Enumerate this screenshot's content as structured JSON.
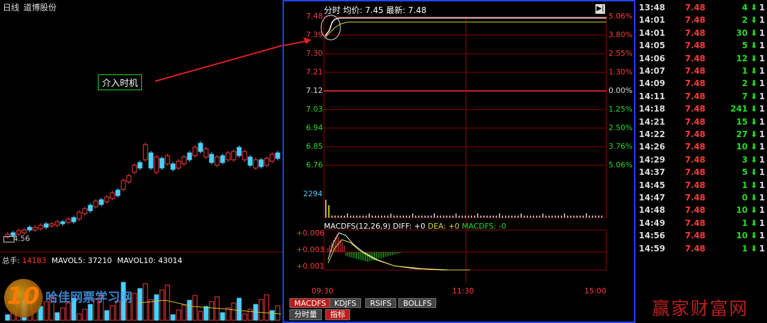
{
  "left": {
    "chart_type": "日线",
    "stock_name": "道博股份",
    "price_label": "4.56",
    "annotation": "介入时机",
    "vol_label": "总手:",
    "vol_value": "14183",
    "mavol5_label": "MAVOL5:",
    "mavol5_value": "37210",
    "mavol10_label": "MAVOL10:",
    "mavol10_value": "43014",
    "watermark_text": "哈佳网票学习网",
    "watermark_logo": "10"
  },
  "mid": {
    "title_label": "分时",
    "avg_label": "均价:",
    "avg_value": "7.45",
    "latest_label": "最新:",
    "latest_value": "7.48",
    "price_ticks": [
      "7.48",
      "7.39",
      "7.30",
      "7.21",
      "7.12",
      "7.03",
      "6.94",
      "6.85",
      "6.76"
    ],
    "pct_ticks": [
      "5.06%",
      "3.80%",
      "2.55%",
      "1.30%",
      "0.00%",
      "1.25%",
      "2.50%",
      "3.76%",
      "5.06%"
    ],
    "vol_max": "2294",
    "macd_header": "MACDFS(12,26,9)",
    "diff_text": "DIFF: +0",
    "dea_text": "DEA: +0",
    "macdfs_text": "MACDFS: -0",
    "macd_ticks": [
      "+0.006",
      "+0.003",
      "+0.001"
    ],
    "time_ticks": [
      "09:30",
      "11:30",
      "15:00"
    ],
    "tabs": [
      "MACDFS",
      "KDJFS",
      "RSIFS",
      "BOLLFS"
    ],
    "tabs2": [
      "分时量",
      "指标"
    ]
  },
  "trades": [
    {
      "time": "13:48",
      "price": "7.48",
      "vol": "4",
      "x": "1"
    },
    {
      "time": "14:01",
      "price": "7.48",
      "vol": "2",
      "x": "1"
    },
    {
      "time": "14:01",
      "price": "7.48",
      "vol": "30",
      "x": "1"
    },
    {
      "time": "14:05",
      "price": "7.48",
      "vol": "5",
      "x": "1"
    },
    {
      "time": "14:06",
      "price": "7.48",
      "vol": "12",
      "x": "1"
    },
    {
      "time": "14:07",
      "price": "7.48",
      "vol": "1",
      "x": "1"
    },
    {
      "time": "14:09",
      "price": "7.48",
      "vol": "2",
      "x": "1"
    },
    {
      "time": "14:11",
      "price": "7.48",
      "vol": "7",
      "x": "1"
    },
    {
      "time": "14:18",
      "price": "7.48",
      "vol": "241",
      "x": "1"
    },
    {
      "time": "14:21",
      "price": "7.48",
      "vol": "15",
      "x": "1"
    },
    {
      "time": "14:22",
      "price": "7.48",
      "vol": "27",
      "x": "1"
    },
    {
      "time": "14:26",
      "price": "7.48",
      "vol": "10",
      "x": "1"
    },
    {
      "time": "14:29",
      "price": "7.48",
      "vol": "3",
      "x": "1"
    },
    {
      "time": "14:37",
      "price": "7.48",
      "vol": "5",
      "x": "1"
    },
    {
      "time": "14:45",
      "price": "7.48",
      "vol": "1",
      "x": "1"
    },
    {
      "time": "14:47",
      "price": "7.48",
      "vol": "0",
      "x": "1"
    },
    {
      "time": "14:48",
      "price": "7.48",
      "vol": "10",
      "x": "1"
    },
    {
      "time": "14:49",
      "price": "7.48",
      "vol": "1",
      "x": "1"
    },
    {
      "time": "14:56",
      "price": "7.48",
      "vol": "10",
      "x": "1"
    },
    {
      "time": "14:59",
      "price": "7.48",
      "vol": "1",
      "x": "1"
    }
  ],
  "right_watermark": "赢家财富网",
  "colors": {
    "up": "#ff3b3b",
    "down": "#22dd22",
    "border": "#2244ff",
    "grid": "#8b0000"
  }
}
